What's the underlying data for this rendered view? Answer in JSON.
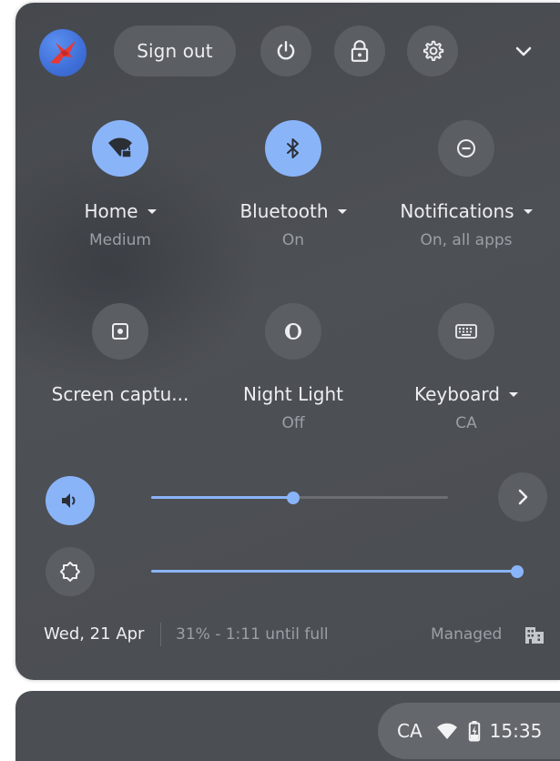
{
  "colors": {
    "accent": "#8ab4f8",
    "panel_bg": "#4b4e53",
    "button_bg": "#5b5e63",
    "primary_text": "#eceef1",
    "secondary_text": "#9aa0a6"
  },
  "header": {
    "sign_out_label": "Sign out",
    "icons": [
      "avatar",
      "power-icon",
      "lock-icon",
      "settings-gear-icon",
      "chevron-down-icon"
    ]
  },
  "tiles": [
    {
      "label": "Home",
      "sublabel": "Medium",
      "icon": "wifi-lock-icon",
      "active": true,
      "has_menu": true
    },
    {
      "label": "Bluetooth",
      "sublabel": "On",
      "icon": "bluetooth-icon",
      "active": true,
      "has_menu": true
    },
    {
      "label": "Notifications",
      "sublabel": "On, all apps",
      "icon": "do-not-disturb-icon",
      "active": false,
      "has_menu": true
    },
    {
      "label": "Screen captu...",
      "sublabel": "",
      "icon": "screen-capture-icon",
      "active": false,
      "has_menu": false
    },
    {
      "label": "Night Light",
      "sublabel": "Off",
      "icon": "night-light-icon",
      "active": false,
      "has_menu": false
    },
    {
      "label": "Keyboard",
      "sublabel": "CA",
      "icon": "keyboard-icon",
      "active": false,
      "has_menu": true
    }
  ],
  "sliders": {
    "volume": {
      "icon": "volume-icon",
      "level": 0.48
    },
    "brightness": {
      "icon": "brightness-icon",
      "level": 1.0
    }
  },
  "footer": {
    "date": "Wed, 21 Apr",
    "battery": "31% - 1:11 until full",
    "managed": "Managed"
  },
  "shelf": {
    "ime": "CA",
    "time": "15:35"
  }
}
